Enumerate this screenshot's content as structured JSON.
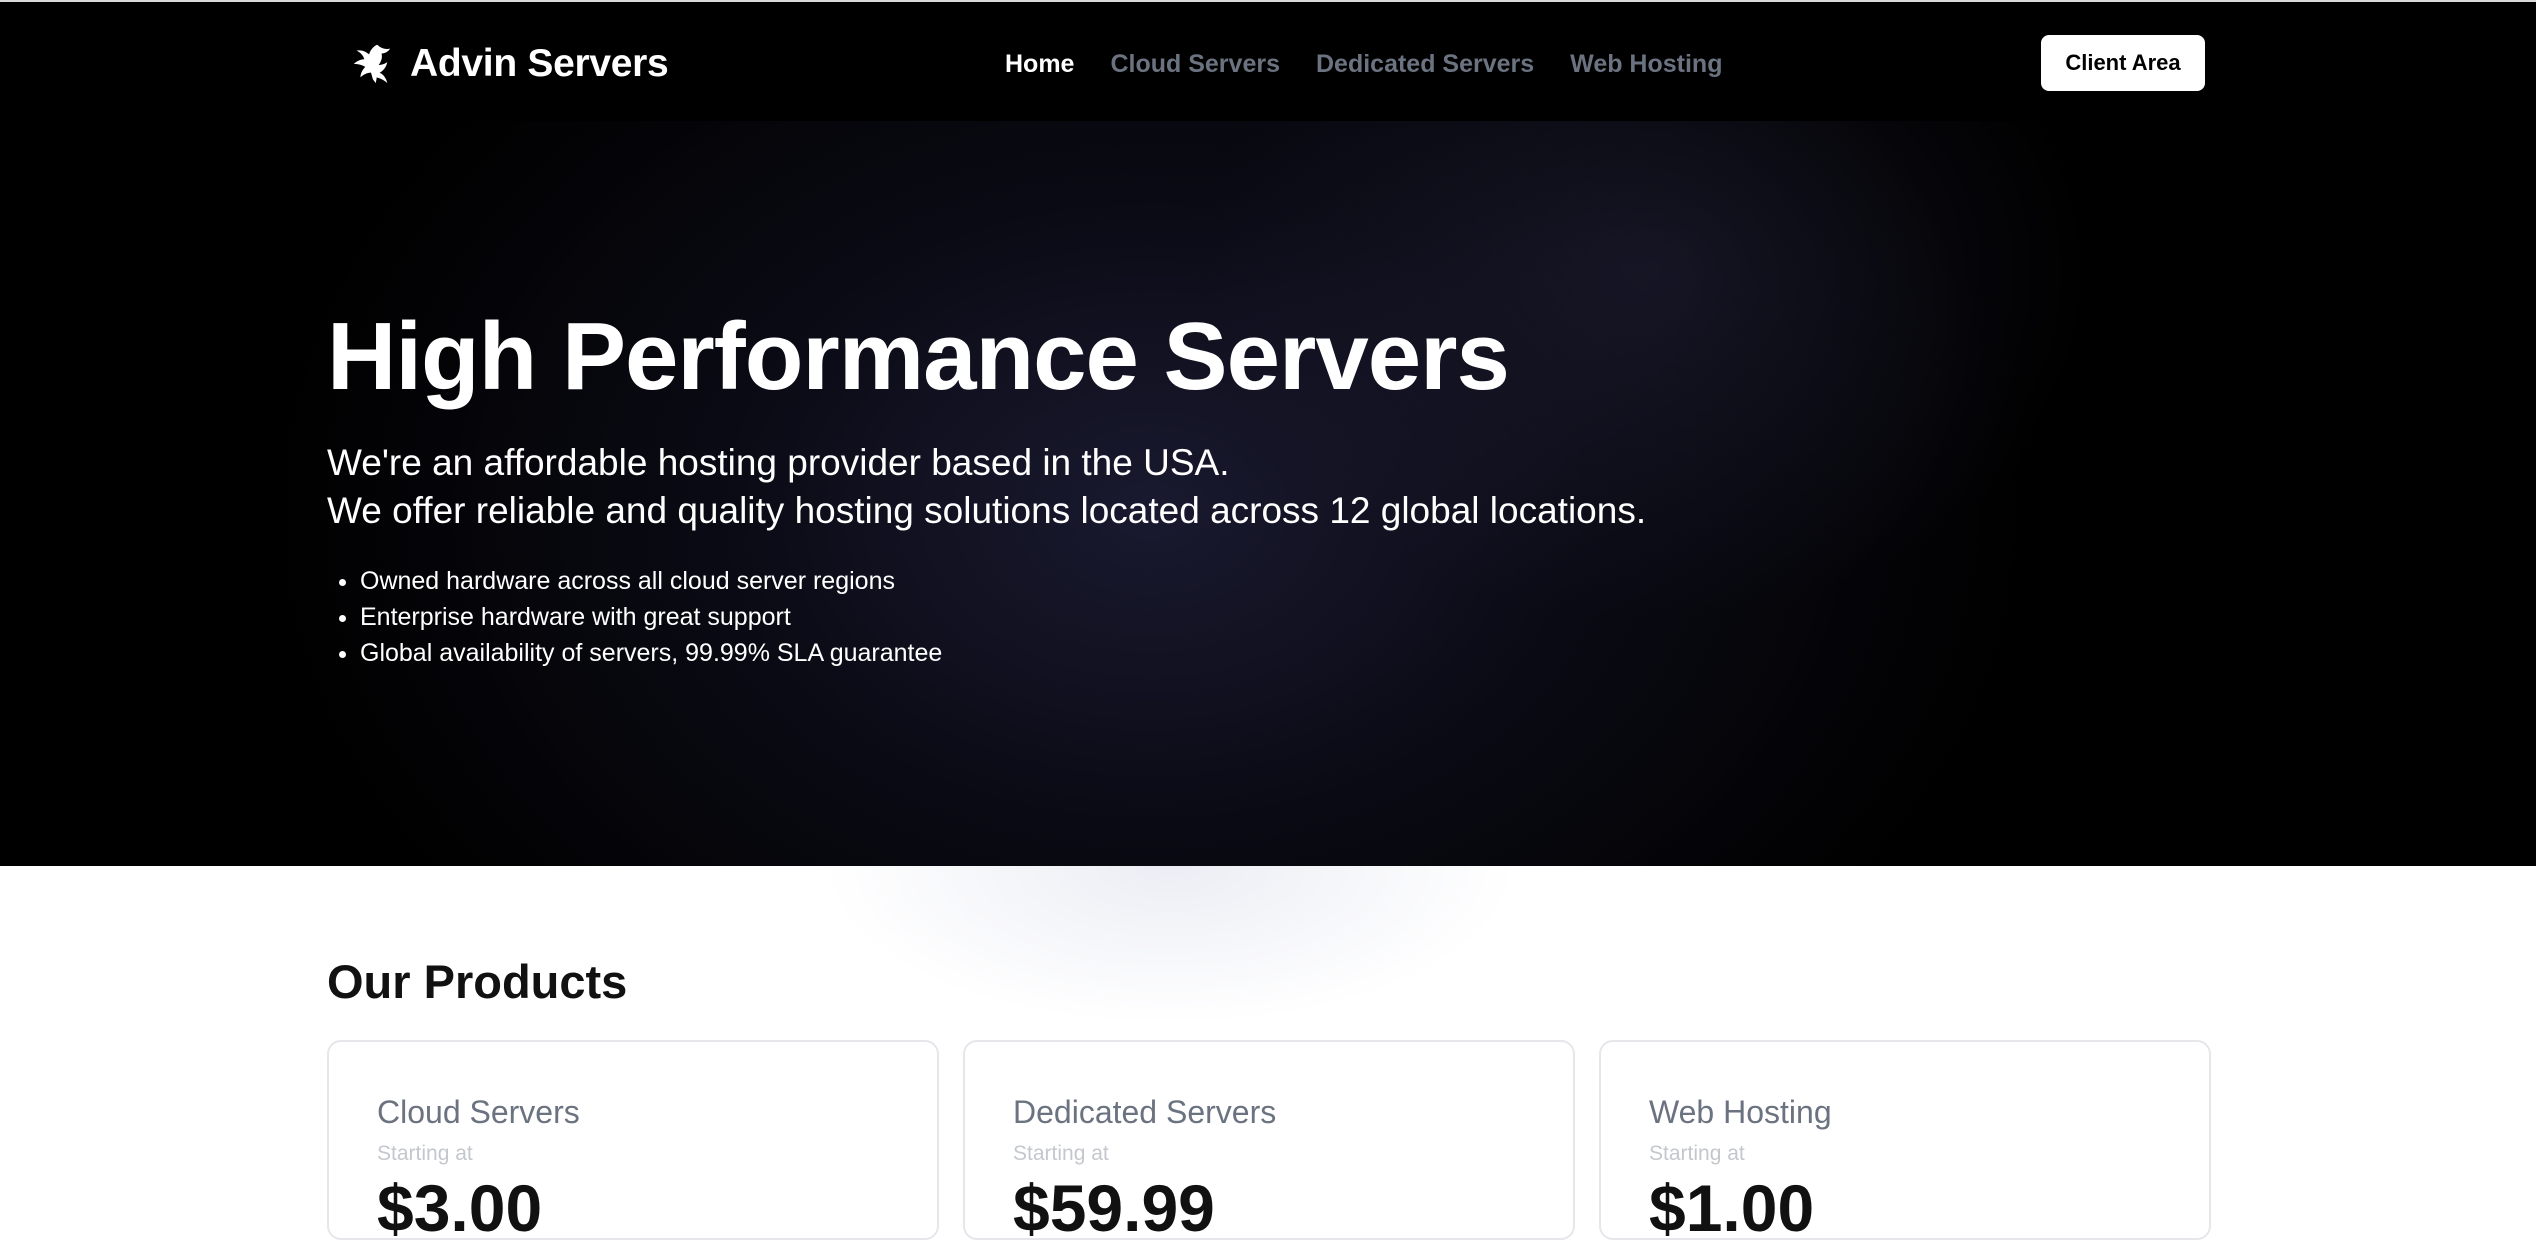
{
  "brand": {
    "name": "Advin Servers",
    "logo_icon": "eagle-logo-icon"
  },
  "nav": {
    "items": [
      {
        "label": "Home",
        "active": true
      },
      {
        "label": "Cloud Servers",
        "active": false
      },
      {
        "label": "Dedicated Servers",
        "active": false
      },
      {
        "label": "Web Hosting",
        "active": false
      }
    ],
    "client_area_label": "Client Area"
  },
  "hero": {
    "title": "High Performance Servers",
    "subtitle_line1": "We're an affordable hosting provider based in the USA.",
    "subtitle_line2": "We offer reliable and quality hosting solutions located across 12 global locations.",
    "bullets": [
      "Owned hardware across all cloud server regions",
      "Enterprise hardware with great support",
      "Global availability of servers, 99.99% SLA guarantee"
    ]
  },
  "products": {
    "title": "Our Products",
    "cards": [
      {
        "name": "Cloud Servers",
        "starting_label": "Starting at",
        "price": "$3.00"
      },
      {
        "name": "Dedicated Servers",
        "starting_label": "Starting at",
        "price": "$59.99"
      },
      {
        "name": "Web Hosting",
        "starting_label": "Starting at",
        "price": "$1.00"
      }
    ]
  },
  "colors": {
    "nav_background": "#000000",
    "nav_inactive": "#6b7280",
    "nav_active": "#ffffff",
    "card_border": "#e5e7eb"
  }
}
